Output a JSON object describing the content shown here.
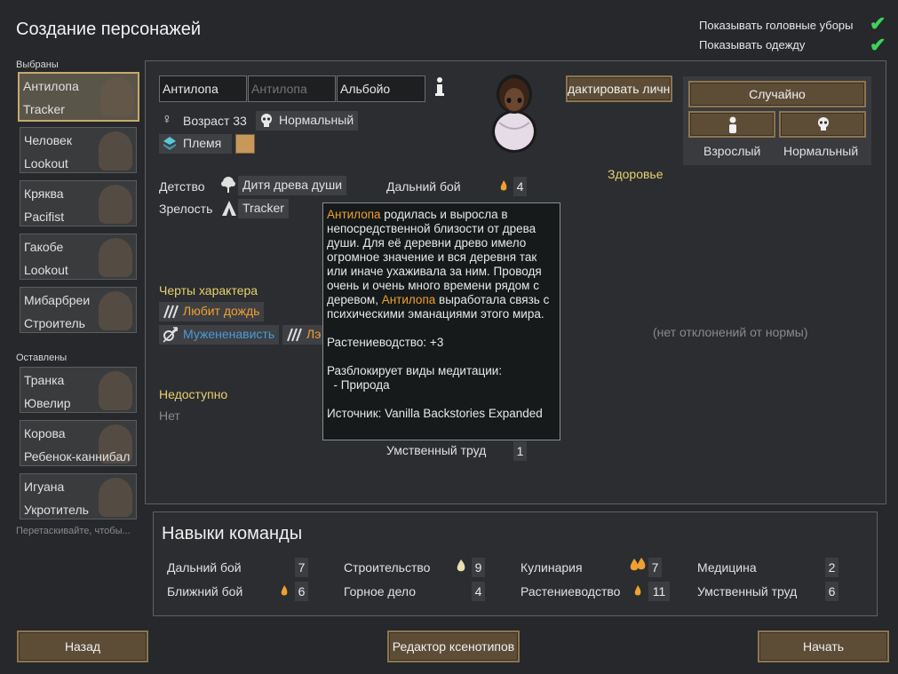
{
  "title": "Создание персонажей",
  "toggles": {
    "headgear": "Показывать головные уборы",
    "clothing": "Показывать одежду"
  },
  "sidebar": {
    "chosen_label": "Выбраны",
    "left_label": "Оставлены",
    "drag_hint": "Перетаскивайте, чтобы...",
    "chosen": [
      {
        "name": "Антилопа",
        "title": "Tracker"
      },
      {
        "name": "Человек",
        "title": "Lookout"
      },
      {
        "name": "Кряква",
        "title": "Pacifist"
      },
      {
        "name": "Гакобе",
        "title": "Lookout"
      },
      {
        "name": "Мибарбреи",
        "title": "Строитель"
      }
    ],
    "left": [
      {
        "name": "Транка",
        "title": "Ювелир"
      },
      {
        "name": "Корова",
        "title": "Ребенок-каннибал"
      },
      {
        "name": "Игуана",
        "title": "Укротитель"
      }
    ]
  },
  "pawn": {
    "first": "Антилопа",
    "nick_placeholder": "Антилопа",
    "last": "Альбойо",
    "age": "Возраст 33",
    "body": "Нормальный",
    "faction": "Племя",
    "edit_button": "дактировать лично",
    "random_button": "Случайно",
    "adult_label": "Взрослый",
    "normal_label": "Нормальный",
    "childhood_label": "Детство",
    "childhood": "Дитя древа души",
    "adulthood_label": "Зрелость",
    "adulthood": "Tracker",
    "traits_label": "Черты характера",
    "traits": [
      "Любит дождь",
      "Мужененависть",
      "Лэ"
    ],
    "incapable_label": "Недоступно",
    "incapable": "Нет",
    "health_label": "Здоровье",
    "health_status": "(нет отклонений от нормы)",
    "skill_top": {
      "name": "Дальний бой",
      "value": "4"
    },
    "skill_bottom": {
      "name": "Умственный труд",
      "value": "1"
    }
  },
  "tooltip": {
    "name1": "Антилопа",
    "text1": " родилась и выросла в непосредственной близости от древа души. Для её деревни древо имело огромное значение и вся деревня так или иначе ухаживала за ним. Проводя очень и очень много времени рядом с деревом, ",
    "name2": "Антилопа",
    "text2": " выработала связь с психическими эманациями этого мира.",
    "bonus": "Растениеводство: +3",
    "unlock": "Разблокирует виды медитации:",
    "unlock_item": "  - Природа",
    "source": "Источник: Vanilla Backstories Expanded"
  },
  "team": {
    "title": "Навыки команды",
    "skills": [
      {
        "name": "Дальний бой",
        "value": "7",
        "passion": 0
      },
      {
        "name": "Ближний бой",
        "value": "6",
        "passion": 1
      },
      {
        "name": "Строительство",
        "value": "9",
        "passion": 1
      },
      {
        "name": "Горное дело",
        "value": "4",
        "passion": 0
      },
      {
        "name": "Кулинария",
        "value": "7",
        "passion": 2
      },
      {
        "name": "Растениеводство",
        "value": "11",
        "passion": 1
      },
      {
        "name": "Медицина",
        "value": "2",
        "passion": 0
      },
      {
        "name": "Умственный труд",
        "value": "6",
        "passion": 0
      }
    ]
  },
  "buttons": {
    "back": "Назад",
    "xeno": "Редактор ксенотипов",
    "start": "Начать"
  },
  "colors": {
    "accent": "#e8d06e",
    "passion": "#f0a030",
    "check": "#3cd35a"
  }
}
